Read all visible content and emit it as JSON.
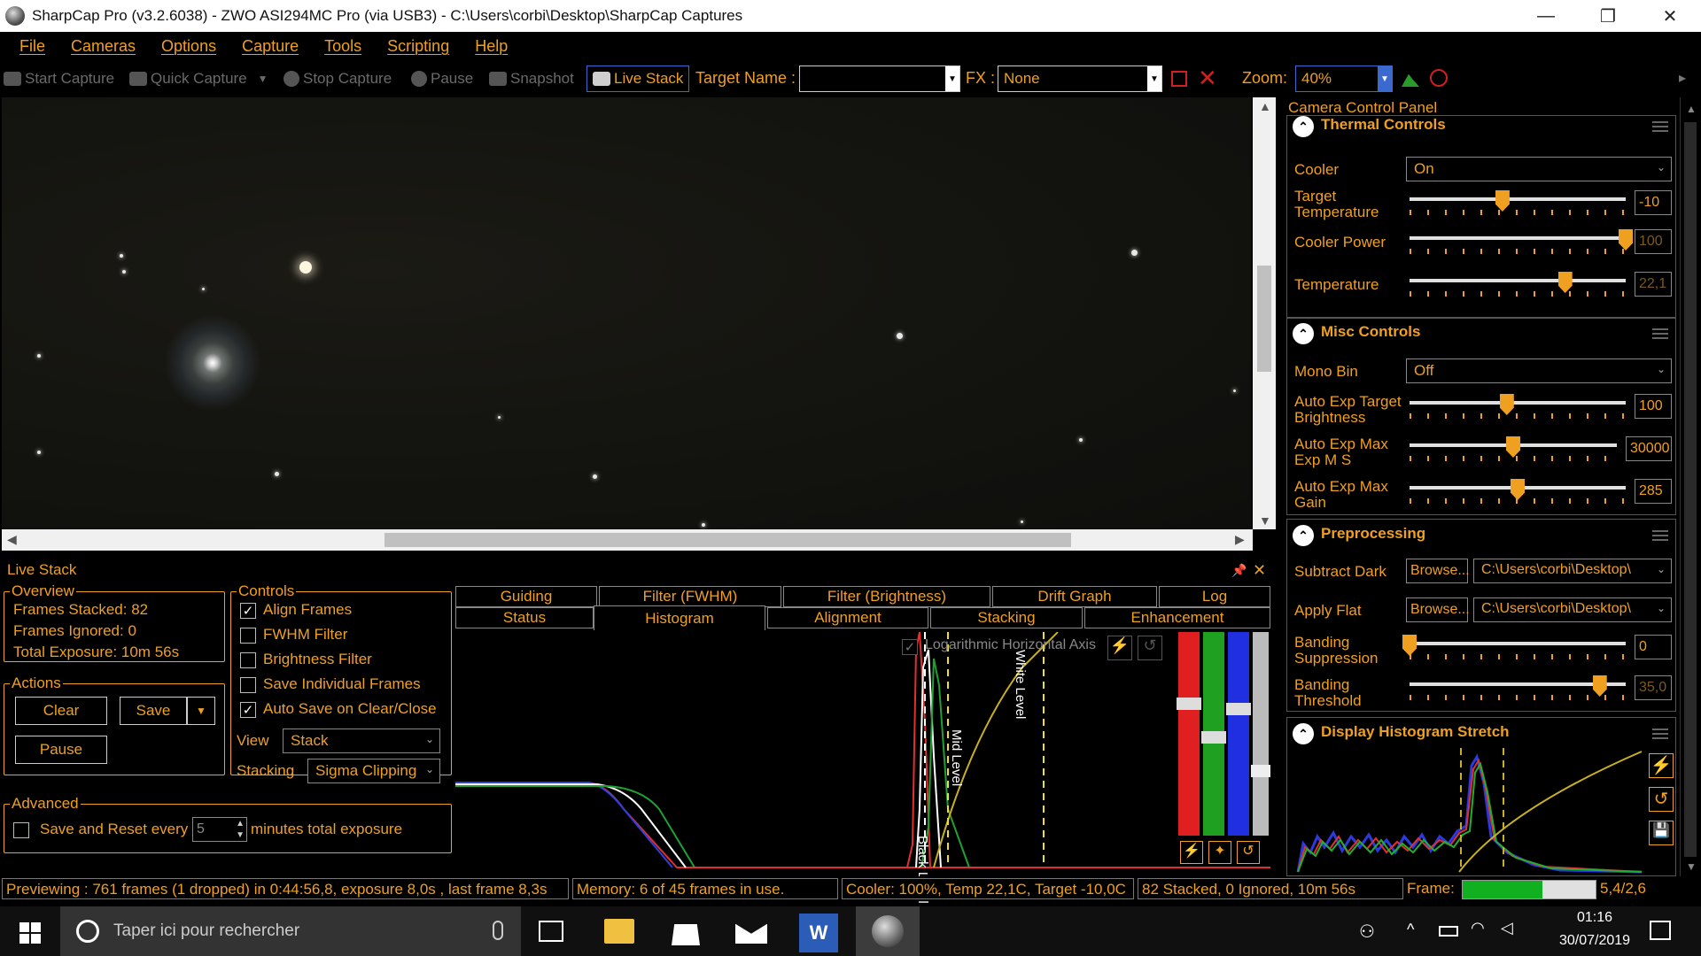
{
  "titlebar": {
    "title": "SharpCap Pro (v3.2.6038) - ZWO ASI294MC Pro (via USB3) - C:\\Users\\corbi\\Desktop\\SharpCap Captures",
    "min": "—",
    "max": "❐",
    "close": "✕"
  },
  "menu": [
    "File",
    "Cameras",
    "Options",
    "Capture",
    "Tools",
    "Scripting",
    "Help"
  ],
  "toolbar": {
    "start_capture": "Start Capture",
    "quick_capture": "Quick Capture",
    "stop_capture": "Stop Capture",
    "pause": "Pause",
    "snapshot": "Snapshot",
    "live_stack": "Live Stack",
    "target_name_label": "Target Name :",
    "target_name_value": "",
    "fx_label": "FX :",
    "fx_value": "None",
    "zoom_label": "Zoom:",
    "zoom_value": "40%"
  },
  "camera_panel": {
    "title": "Camera Control Panel",
    "thermal": {
      "title": "Thermal Controls",
      "cooler_label": "Cooler",
      "cooler_value": "On",
      "target_temp_label": "Target\nTemperature",
      "target_temp_value": "-10",
      "target_temp_level": 0.43,
      "cooler_power_label": "Cooler Power",
      "cooler_power_value": "100",
      "cooler_power_level": 1.0,
      "temperature_label": "Temperature",
      "temperature_value": "22,1",
      "temperature_level": 0.72
    },
    "misc": {
      "title": "Misc Controls",
      "mono_bin_label": "Mono Bin",
      "mono_bin_value": "Off",
      "ae_target_label": "Auto Exp Target\nBrightness",
      "ae_target_value": "100",
      "ae_target_level": 0.45,
      "ae_max_exp_label": "Auto Exp Max\nExp M S",
      "ae_max_exp_value": "30000",
      "ae_max_exp_level": 0.5,
      "ae_max_gain_label": "Auto Exp Max\nGain",
      "ae_max_gain_value": "285",
      "ae_max_gain_level": 0.5
    },
    "preprocessing": {
      "title": "Preprocessing",
      "subtract_dark_label": "Subtract Dark",
      "browse1": "Browse...",
      "dark_path": "C:\\Users\\corbi\\Desktop\\",
      "apply_flat_label": "Apply Flat",
      "browse2": "Browse...",
      "flat_path": "C:\\Users\\corbi\\Desktop\\",
      "banding_supp_label": "Banding\nSuppression",
      "banding_supp_value": "0",
      "banding_supp_level": 0.0,
      "banding_thr_label": "Banding\nThreshold",
      "banding_thr_value": "35,0",
      "banding_thr_level": 0.88
    },
    "histogram_stretch": {
      "title": "Display Histogram Stretch"
    }
  },
  "live_stack": {
    "title": "Live Stack",
    "overview": {
      "title": "Overview",
      "frames_stacked": "Frames Stacked:  82",
      "frames_ignored": "Frames Ignored:  0",
      "total_exposure": "Total Exposure:   10m 56s"
    },
    "actions": {
      "title": "Actions",
      "clear": "Clear",
      "save": "Save",
      "pause": "Pause"
    },
    "controls": {
      "title": "Controls",
      "align_frames": "Align Frames",
      "fwhm_filter": "FWHM Filter",
      "brightness_filter": "Brightness Filter",
      "save_individual": "Save Individual Frames",
      "auto_save": "Auto Save on Clear/Close",
      "view_label": "View",
      "view_value": "Stack",
      "stacking_label": "Stacking",
      "stacking_value": "Sigma Clipping"
    },
    "advanced": {
      "title": "Advanced",
      "save_reset_label": "Save and Reset every",
      "minutes_value": "5",
      "minutes_suffix": "minutes total exposure"
    },
    "tabs_top": [
      "Guiding",
      "Filter (FWHM)",
      "Filter (Brightness)",
      "Drift Graph",
      "Log"
    ],
    "tabs_bottom": [
      "Status",
      "Histogram",
      "Alignment",
      "Stacking",
      "Enhancement"
    ],
    "active_tab": "Histogram",
    "histogram": {
      "log_axis_label": "Logarithmic Horizontal Axis",
      "black_level": "Black Level",
      "mid_level": "Mid Level",
      "white_level": "White Level"
    }
  },
  "statusbar": {
    "previewing": "Previewing : 761 frames (1 dropped) in 0:44:56,8, exposure 8,0s , last frame 8,3s",
    "memory": "Memory: 6 of 45 frames in use.",
    "cooler": "Cooler: 100%, Temp 22,1C, Target -10,0C",
    "stacked": "82 Stacked, 0 Ignored, 10m 56s",
    "frame_label": "Frame:",
    "frame_value": "5,4/2,6",
    "frame_progress": 0.6
  },
  "taskbar": {
    "search_placeholder": "Taper ici pour rechercher",
    "time": "01:16",
    "date": "30/07/2019"
  },
  "colors": {
    "accent": "#f0a020",
    "background": "#000000"
  }
}
